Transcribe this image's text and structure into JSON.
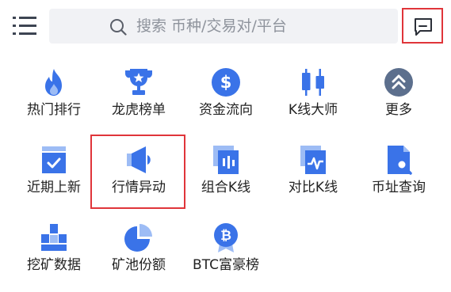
{
  "accent_color": "#3a73e8",
  "highlight_color": "#e0353a",
  "header": {
    "menu_icon": "menu-list-icon",
    "search": {
      "placeholder": "搜索 币种/交易对/平台",
      "icon": "search-icon"
    },
    "message_icon": "message-icon"
  },
  "grid": {
    "items": [
      {
        "label": "热门排行",
        "icon": "flame-icon"
      },
      {
        "label": "龙虎榜单",
        "icon": "trophy-icon"
      },
      {
        "label": "资金流向",
        "icon": "dollar-coin-icon"
      },
      {
        "label": "K线大师",
        "icon": "candlestick-icon"
      },
      {
        "label": "更多",
        "icon": "chevron-up-double-icon"
      },
      {
        "label": "近期上新",
        "icon": "calendar-check-icon"
      },
      {
        "label": "行情异动",
        "icon": "megaphone-icon"
      },
      {
        "label": "组合K线",
        "icon": "combo-chart-icon"
      },
      {
        "label": "对比K线",
        "icon": "compare-chart-icon"
      },
      {
        "label": "币址查询",
        "icon": "address-search-icon"
      },
      {
        "label": "挖矿数据",
        "icon": "mining-gold-icon"
      },
      {
        "label": "矿池份额",
        "icon": "pie-chart-icon"
      },
      {
        "label": "BTC富豪榜",
        "icon": "bitcoin-badge-icon"
      }
    ]
  }
}
